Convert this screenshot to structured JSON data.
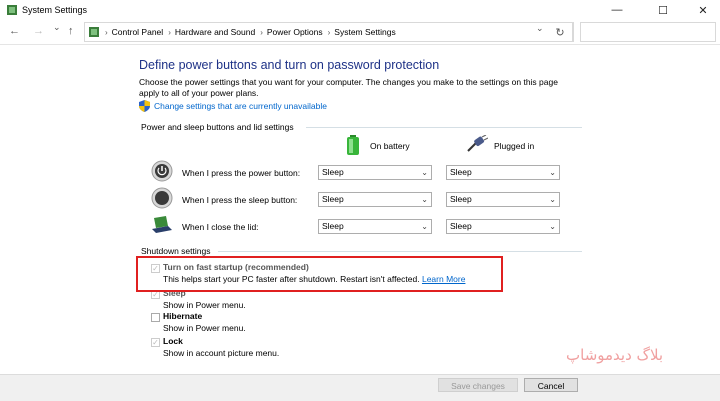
{
  "window": {
    "title": "System Settings",
    "minimize": "—",
    "maximize": "☐",
    "close": "✕"
  },
  "address": {
    "back": "←",
    "forward": "→",
    "recent": "⌄",
    "up": "↑",
    "breadcrumbs": [
      "Control Panel",
      "Hardware and Sound",
      "Power Options",
      "System Settings"
    ],
    "dropdown": "⌄",
    "refresh": "↻"
  },
  "main": {
    "heading": "Define power buttons and turn on password protection",
    "intro": "Choose the power settings that you want for your computer. The changes you make to the settings on this page apply to all of your power plans.",
    "change_link": "Change settings that are currently unavailable"
  },
  "power_group": {
    "title": "Power and sleep buttons and lid settings",
    "columns": [
      "On battery",
      "Plugged in"
    ],
    "rows": [
      {
        "label": "When I press the power button:",
        "battery": "Sleep",
        "plugged": "Sleep"
      },
      {
        "label": "When I press the sleep button:",
        "battery": "Sleep",
        "plugged": "Sleep"
      },
      {
        "label": "When I close the lid:",
        "battery": "Sleep",
        "plugged": "Sleep"
      }
    ]
  },
  "shutdown": {
    "title": "Shutdown settings",
    "options": [
      {
        "label": "Turn on fast startup (recommended)",
        "desc": "This helps start your PC faster after shutdown. Restart isn't affected.",
        "link": "Learn More",
        "checked": true
      },
      {
        "label": "Sleep",
        "desc": "Show in Power menu.",
        "checked": true
      },
      {
        "label": "Hibernate",
        "desc": "Show in Power menu.",
        "checked": false
      },
      {
        "label": "Lock",
        "desc": "Show in account picture menu.",
        "checked": true
      }
    ]
  },
  "footer": {
    "save": "Save changes",
    "cancel": "Cancel"
  },
  "watermark": "بلاگ دیدموشاپ",
  "icons": {
    "app": "control-panel-icon",
    "shield": "uac-shield-icon",
    "battery": "battery-icon",
    "plug": "plug-icon",
    "power": "power-button-icon",
    "sleep": "sleep-button-icon",
    "lid": "laptop-lid-icon",
    "chevron": "chevron-down-icon"
  },
  "colors": {
    "heading": "#1e3287",
    "link": "#0066cc",
    "highlight": "#e02020"
  }
}
